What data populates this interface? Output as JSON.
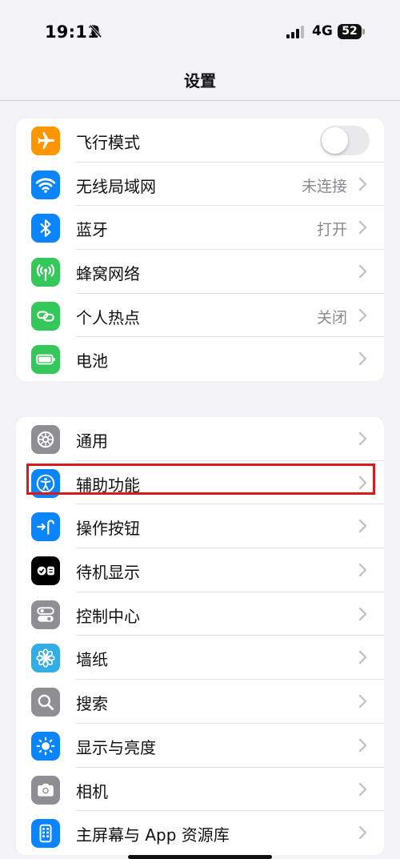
{
  "status_bar": {
    "time": "19:11",
    "network": "4G",
    "battery": "52"
  },
  "nav": {
    "title": "设置"
  },
  "group1": [
    {
      "label": "飞行模式",
      "icon": "airplane-icon",
      "color": "#ff9500",
      "toggle": false
    },
    {
      "label": "无线局域网",
      "icon": "wifi-icon",
      "color": "#0a84ff",
      "value": "未连接"
    },
    {
      "label": "蓝牙",
      "icon": "bluetooth-icon",
      "color": "#0a84ff",
      "value": "打开"
    },
    {
      "label": "蜂窝网络",
      "icon": "cellular-antenna-icon",
      "color": "#34c759"
    },
    {
      "label": "个人热点",
      "icon": "hotspot-link-icon",
      "color": "#34c759",
      "value": "关闭"
    },
    {
      "label": "电池",
      "icon": "battery-icon",
      "color": "#34c759"
    }
  ],
  "group2": [
    {
      "label": "通用",
      "icon": "gear-icon",
      "color": "#8e8e93"
    },
    {
      "label": "辅助功能",
      "icon": "accessibility-icon",
      "color": "#0a84ff",
      "highlighted": true
    },
    {
      "label": "操作按钮",
      "icon": "action-button-icon",
      "color": "#0a84ff"
    },
    {
      "label": "待机显示",
      "icon": "standby-icon",
      "color": "#000000"
    },
    {
      "label": "控制中心",
      "icon": "toggles-icon",
      "color": "#8e8e93"
    },
    {
      "label": "墙纸",
      "icon": "flower-icon",
      "color": "#32ade6"
    },
    {
      "label": "搜索",
      "icon": "search-icon",
      "color": "#8e8e93"
    },
    {
      "label": "显示与亮度",
      "icon": "sun-icon",
      "color": "#0a84ff"
    },
    {
      "label": "相机",
      "icon": "camera-icon",
      "color": "#8e8e93"
    },
    {
      "label": "主屏幕与 App 资源库",
      "icon": "home-screen-icon",
      "color": "#0a84ff"
    }
  ]
}
